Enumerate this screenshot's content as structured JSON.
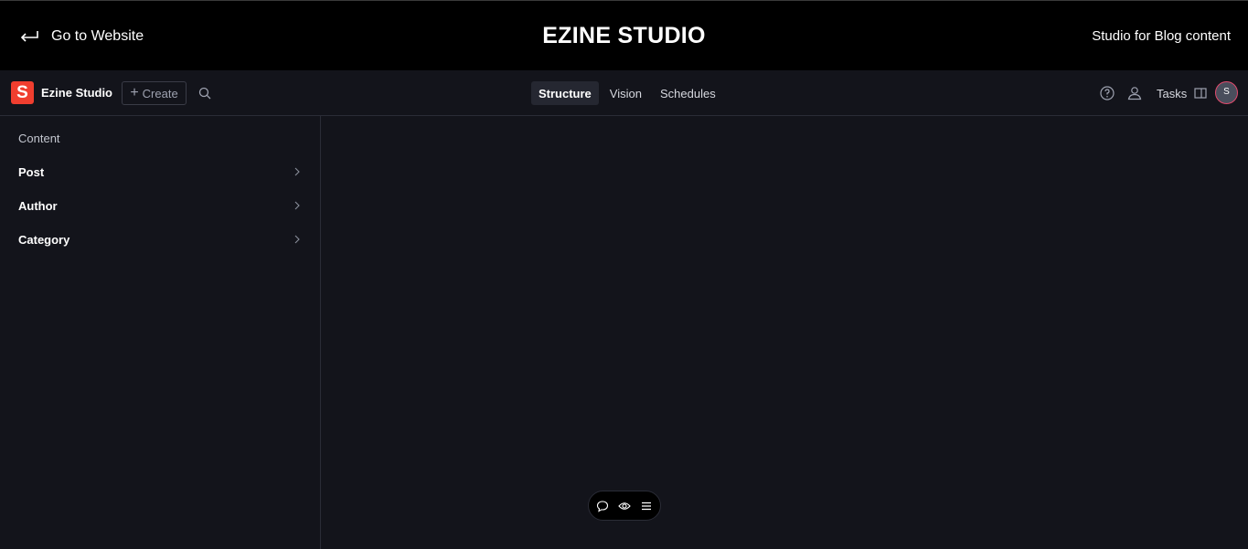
{
  "topbar": {
    "back_label": "Go to Website",
    "brand": "EZINE STUDIO",
    "tagline": "Studio for Blog content"
  },
  "navbar": {
    "logo_letter": "S",
    "studio_name": "Ezine Studio",
    "create_label": "Create",
    "tabs": [
      {
        "label": "Structure",
        "active": true
      },
      {
        "label": "Vision",
        "active": false
      },
      {
        "label": "Schedules",
        "active": false
      }
    ],
    "tasks_label": "Tasks",
    "avatar_initial": "S"
  },
  "sidebar": {
    "heading": "Content",
    "items": [
      {
        "label": "Post"
      },
      {
        "label": "Author"
      },
      {
        "label": "Category"
      }
    ]
  },
  "icons": {
    "back": "arrow-return-left-icon",
    "search": "search-icon",
    "help": "help-circle-icon",
    "presence": "users-icon",
    "tasks_panel": "panel-split-icon",
    "chevron": "chevron-right-icon",
    "comment": "comment-icon",
    "vision": "eye-icon",
    "menu": "menu-icon"
  },
  "colors": {
    "topbar_bg": "#000000",
    "app_bg": "#13141b",
    "logo_red": "#f03e2f",
    "avatar_ring": "#e24a6d"
  }
}
